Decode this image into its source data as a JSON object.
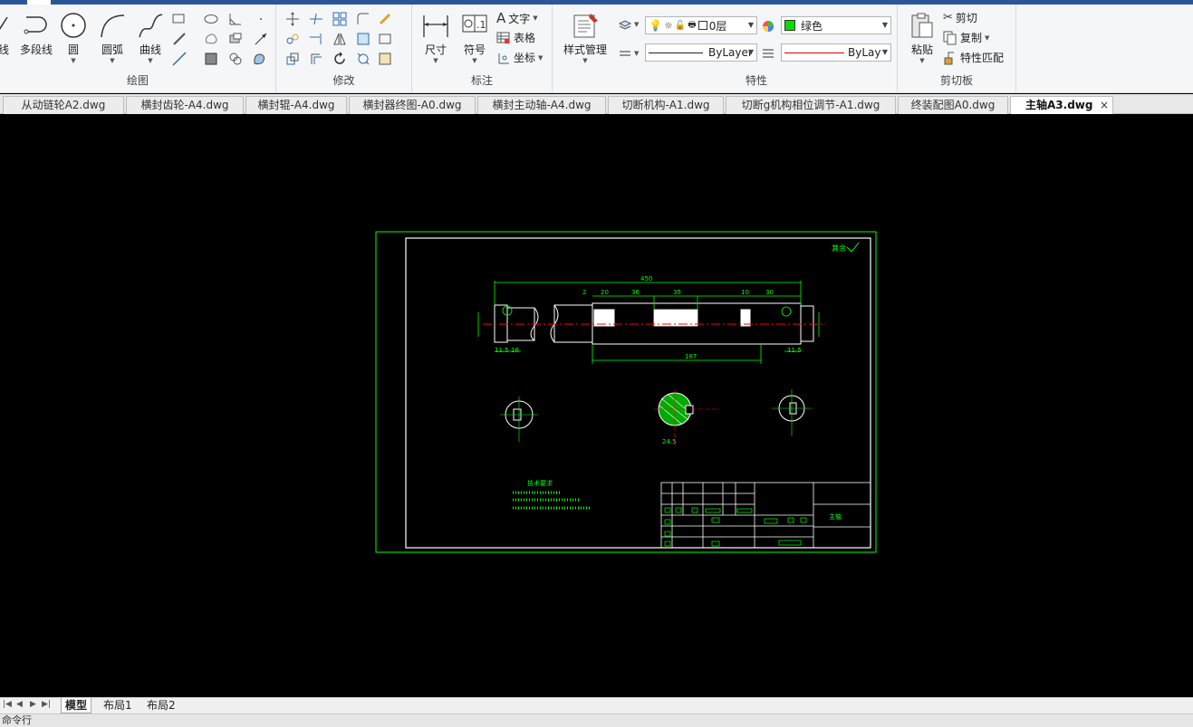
{
  "ribbon": {
    "draw_panel": {
      "label": "绘图",
      "line_label": "线",
      "polyline_label": "多段线",
      "circle_label": "圆",
      "arc_label": "圆弧",
      "curve_label": "曲线"
    },
    "modify_panel": {
      "label": "修改"
    },
    "annotation_panel": {
      "label": "标注",
      "dimension_label": "尺寸",
      "symbol_label": "符号",
      "text_label": "文字",
      "table_label": "表格",
      "coordinate_label": "坐标"
    },
    "style_panel": {
      "style_label": "样式管理"
    },
    "properties_panel": {
      "label": "特性",
      "layer_value": "0层",
      "color_value": "绿色",
      "linetype_value": "ByLayer",
      "lineweight_value": "ByLay"
    },
    "clipboard_panel": {
      "label": "剪切板",
      "paste_label": "粘贴",
      "cut_label": "剪切",
      "copy_label": "复制",
      "match_label": "特性匹配"
    }
  },
  "tabs": [
    {
      "label": "从动链轮A2.dwg"
    },
    {
      "label": "横封齿轮-A4.dwg"
    },
    {
      "label": "横封辊-A4.dwg"
    },
    {
      "label": "横封器终图-A0.dwg"
    },
    {
      "label": "横封主动轴-A4.dwg"
    },
    {
      "label": "切断机构-A1.dwg"
    },
    {
      "label": "切断g机构相位调节-A1.dwg"
    },
    {
      "label": "终装配图A0.dwg"
    },
    {
      "label": "主轴A3.dwg",
      "active": true
    }
  ],
  "tab_close": "×",
  "drawing": {
    "roughness_note": "其余",
    "dim_overall": "450",
    "dim_2": "2",
    "dim_20": "20",
    "dim_36": "36",
    "dim_35": "35",
    "dim_10": "10",
    "dim_30": "30",
    "dim_187": "187",
    "dim_left_small": "11.5",
    "dim_left_16": "16",
    "dim_right_small": "11.5",
    "section_dim": "24.5",
    "title_block_name": "主轴",
    "tech_req_title": "技术要求",
    "colors": {
      "frame": "#00ff00",
      "centerline": "#ff0000",
      "text": "#00ff00",
      "border_white": "#ffffff"
    }
  },
  "layouts": {
    "model_label": "模型",
    "layout1_label": "布局1",
    "layout2_label": "布局2"
  },
  "cmdline": {
    "label": "命令行"
  }
}
